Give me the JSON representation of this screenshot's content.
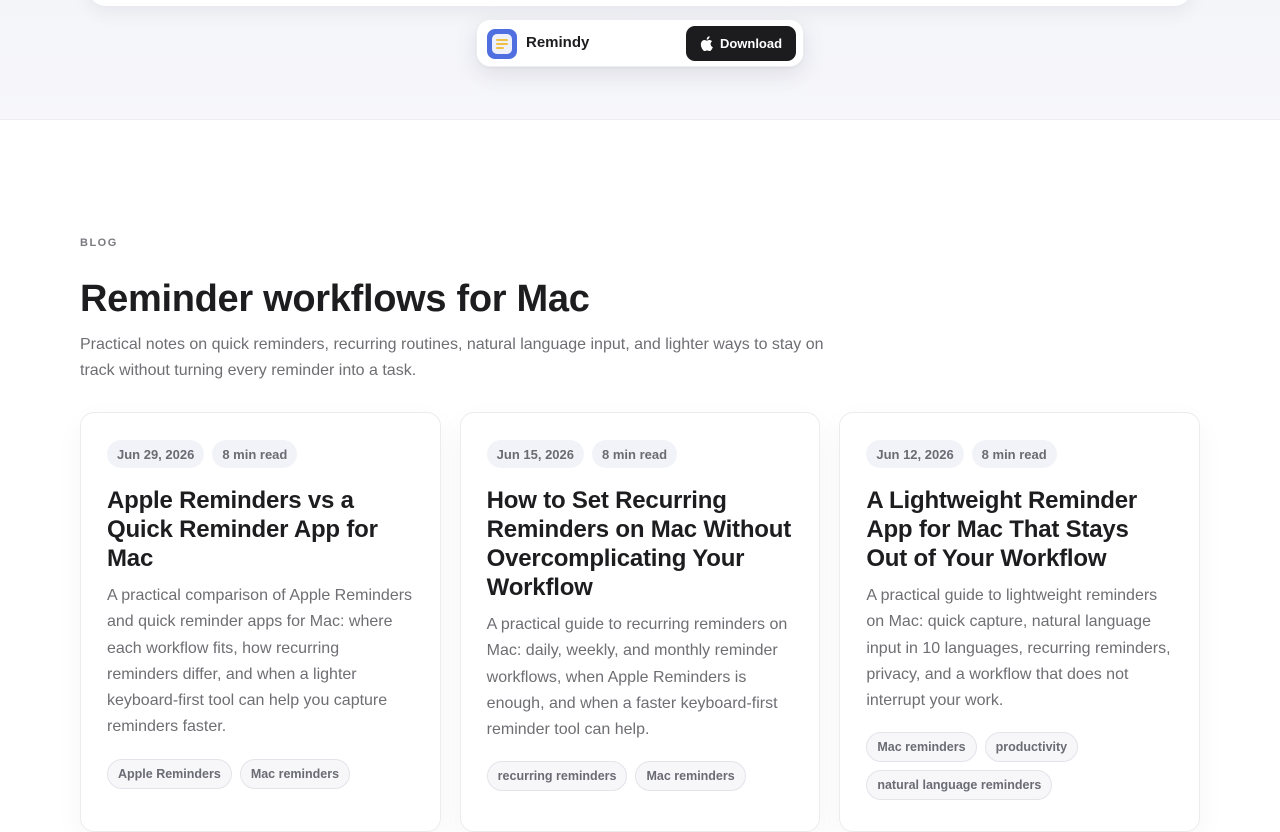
{
  "nav": {
    "app_name": "Remindy",
    "download_label": "Download",
    "colors": {
      "app_icon": "#4f6fe0",
      "download_bg": "#1c1c1e"
    }
  },
  "blog": {
    "eyebrow": "BLOG",
    "title": "Reminder workflows for Mac",
    "intro": "Practical notes on quick reminders, recurring routines, natural language input, and lighter ways to stay on track without turning every reminder into a task."
  },
  "posts": [
    {
      "date": "Jun 29, 2026",
      "read_time": "8 min read",
      "title": "Apple Reminders vs a Quick Reminder App for Mac",
      "excerpt": "A practical comparison of Apple Reminders and quick reminder apps for Mac: where each workflow fits, how recurring reminders differ, and when a lighter keyboard-first tool can help you capture reminders faster.",
      "tags": [
        "Apple Reminders",
        "Mac reminders"
      ]
    },
    {
      "date": "Jun 15, 2026",
      "read_time": "8 min read",
      "title": "How to Set Recurring Reminders on Mac Without Overcomplicating Your Workflow",
      "excerpt": "A practical guide to recurring reminders on Mac: daily, weekly, and monthly reminder workflows, when Apple Reminders is enough, and when a faster keyboard-first reminder tool can help.",
      "tags": [
        "recurring reminders",
        "Mac reminders"
      ]
    },
    {
      "date": "Jun 12, 2026",
      "read_time": "8 min read",
      "title": "A Lightweight Reminder App for Mac That Stays Out of Your Workflow",
      "excerpt": "A practical guide to lightweight reminders on Mac: quick capture, natural language input in 10 languages, recurring reminders, privacy, and a workflow that does not interrupt your work.",
      "tags": [
        "Mac reminders",
        "productivity",
        "natural language reminders"
      ]
    }
  ]
}
